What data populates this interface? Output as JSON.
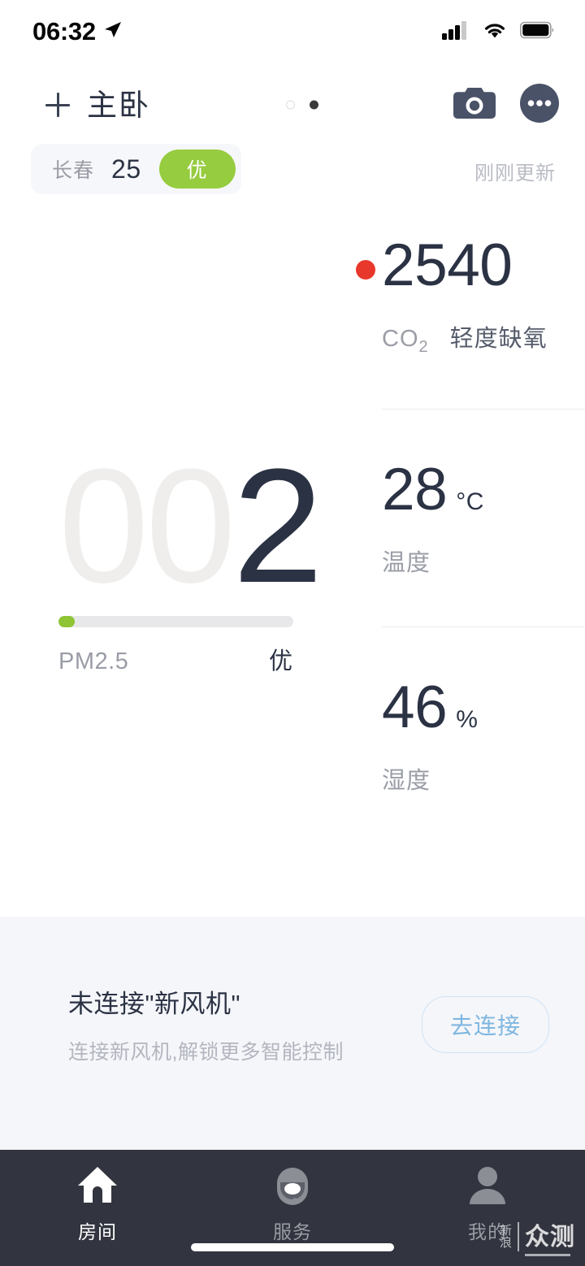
{
  "status_bar": {
    "time": "06:32",
    "location_icon": "location-arrow-icon",
    "signal_icon": "cellular-signal-icon",
    "wifi_icon": "wifi-icon",
    "battery_icon": "battery-full-icon"
  },
  "header": {
    "add_icon": "plus-icon",
    "room_title": "主卧",
    "page_dots": [
      "inactive",
      "active"
    ],
    "camera_icon": "camera-icon",
    "more_icon": "more-options-icon"
  },
  "aqi_chip": {
    "city": "长春",
    "value": "25",
    "badge": "优",
    "badge_color": "#96cc3f"
  },
  "update_status": "刚刚更新",
  "metrics": {
    "co2": {
      "value": "2540",
      "label": "CO",
      "label_sub": "2",
      "status": "轻度缺氧",
      "indicator_color": "#e8382b",
      "unit": ""
    },
    "temperature": {
      "value": "28",
      "unit": "°C",
      "label": "温度"
    },
    "humidity": {
      "value": "46",
      "unit": "%",
      "label": "湿度"
    }
  },
  "pm25": {
    "padding_digits": "00",
    "value_digit": "2",
    "full_value": "002",
    "name": "PM2.5",
    "rating": "优",
    "bar_percent": 7,
    "bar_color": "#8fc434"
  },
  "banner": {
    "title": "未连接\"新风机\"",
    "subtitle": "连接新风机,解锁更多智能控制",
    "button_label": "去连接",
    "accent_color": "#7fb7e0"
  },
  "tab_bar": {
    "tabs": [
      {
        "label": "房间",
        "icon": "home-icon",
        "active": true
      },
      {
        "label": "服务",
        "icon": "headset-icon",
        "active": false
      },
      {
        "label": "我的",
        "icon": "person-icon",
        "active": false
      }
    ]
  },
  "watermark": {
    "line1": "新",
    "line2": "浪",
    "main": "众测"
  }
}
